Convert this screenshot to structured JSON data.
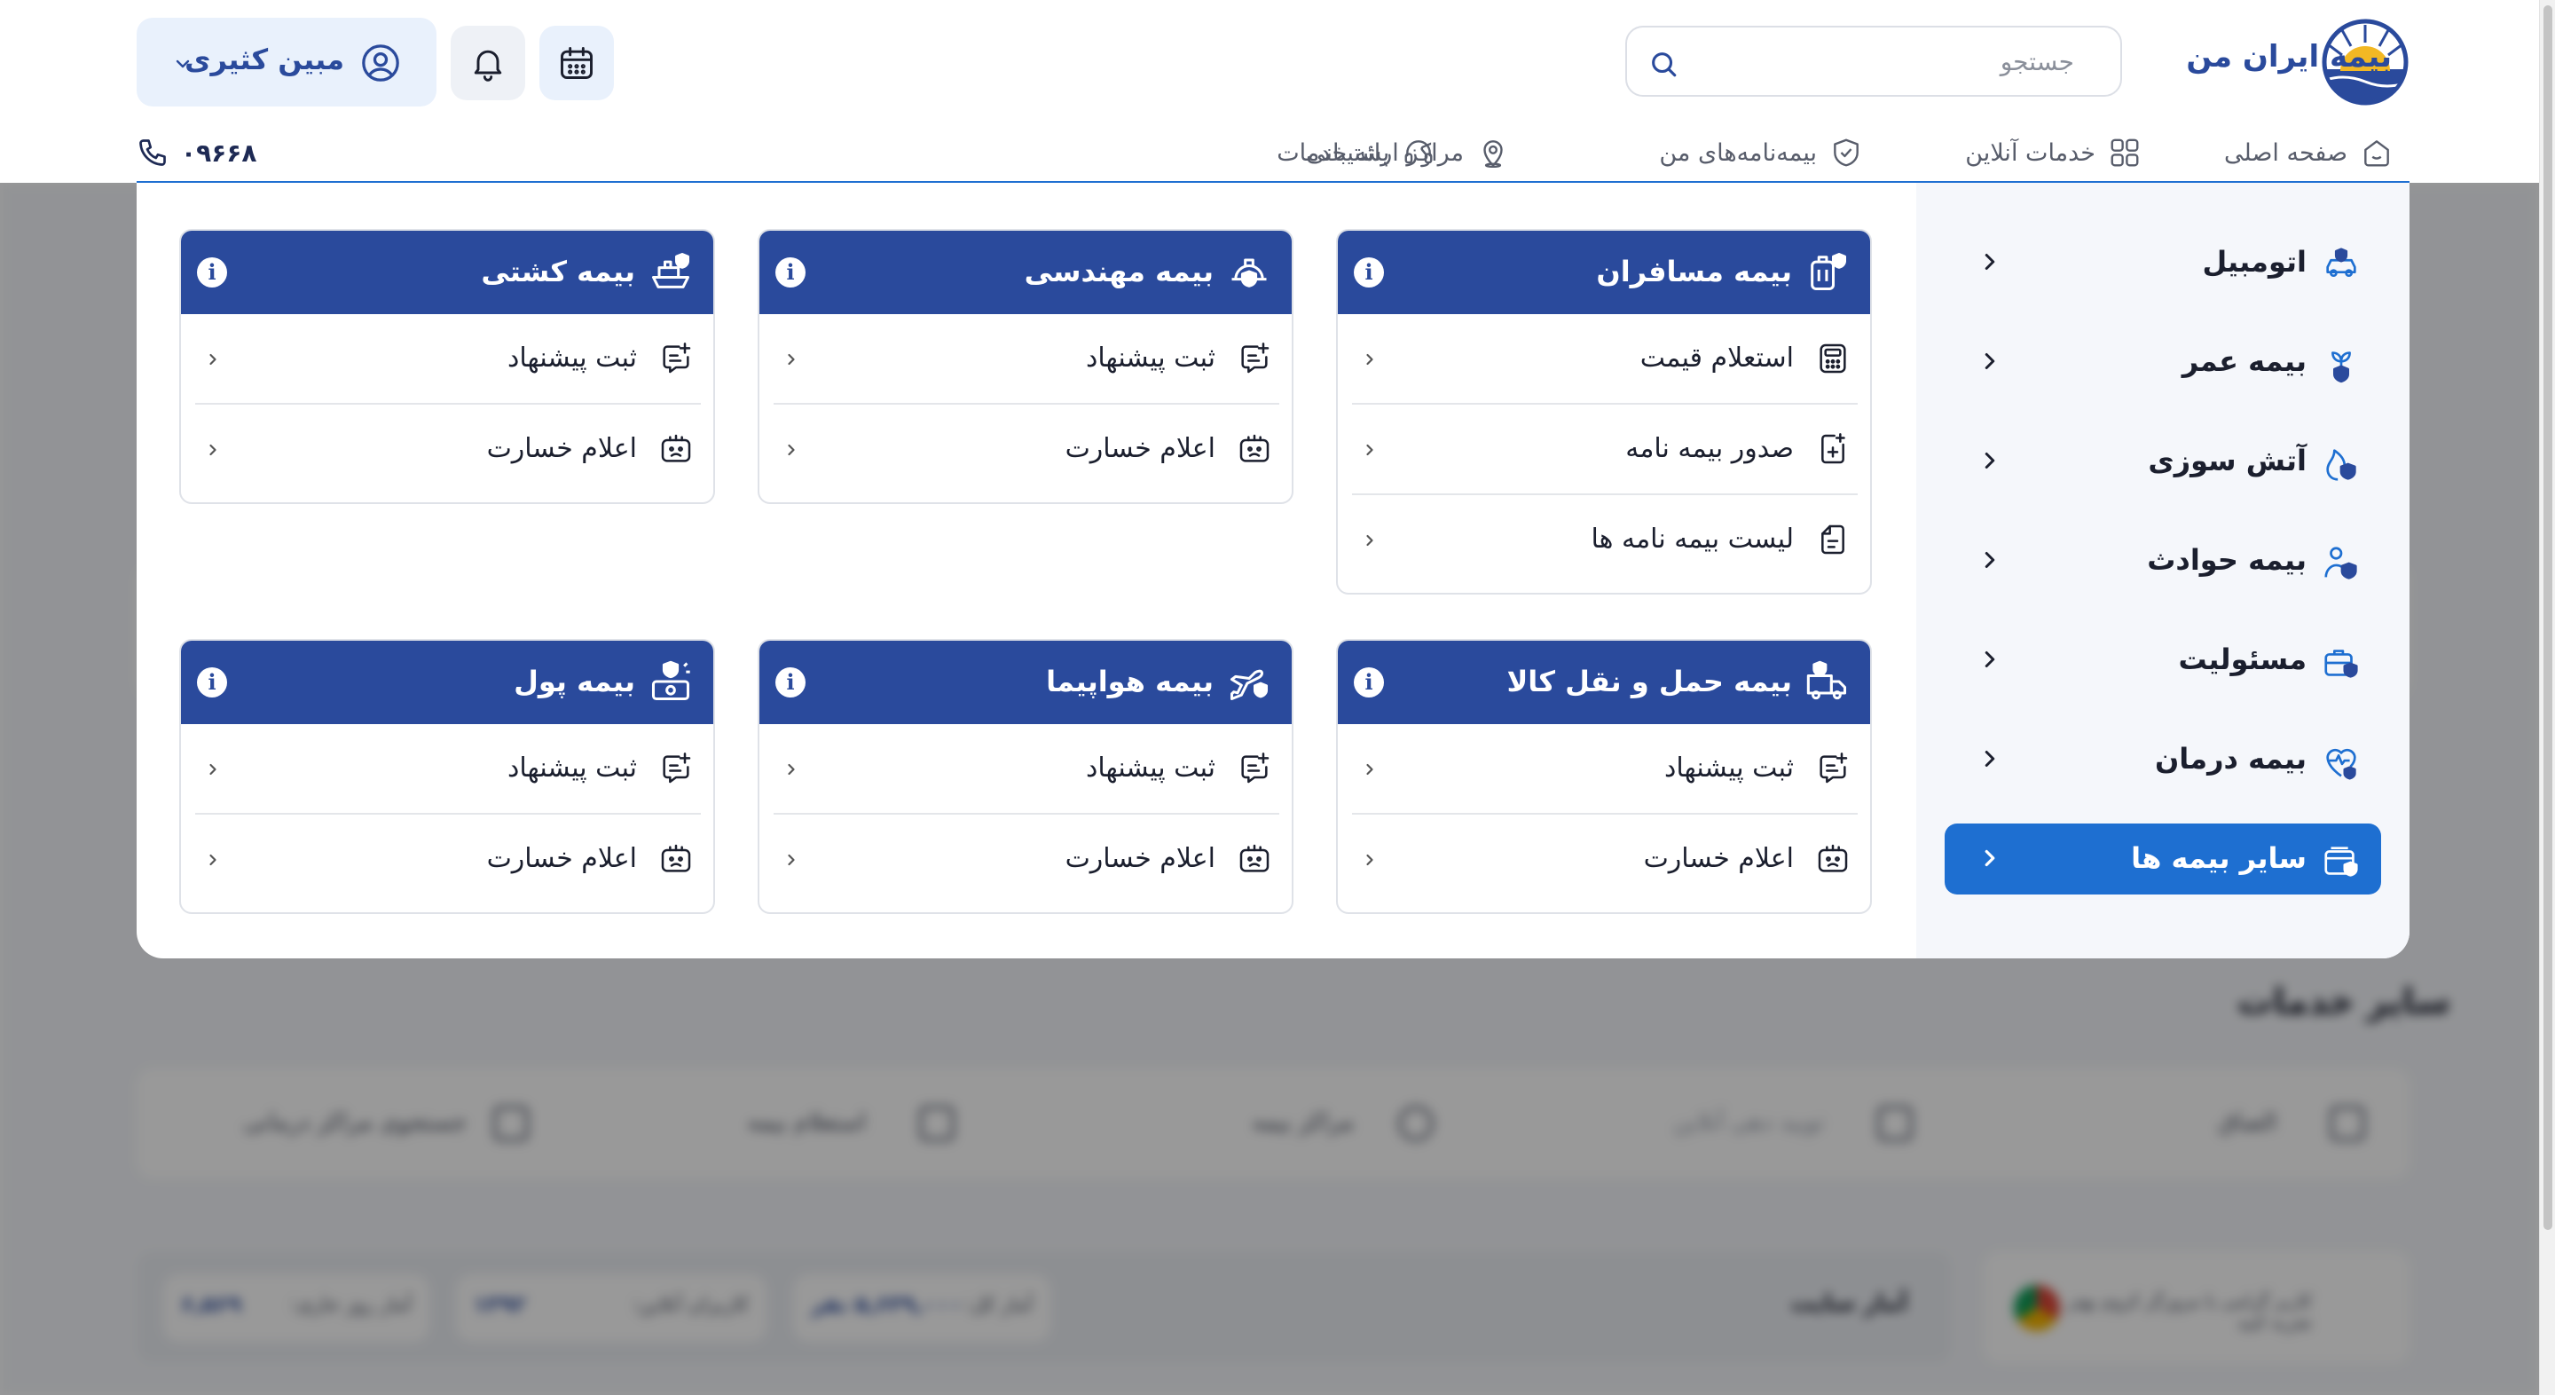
{
  "brand": {
    "name": "بیمه ایران من",
    "colors": {
      "primary": "#2a4a9c",
      "accent": "#1e6fd1",
      "logo_yellow": "#f2b824"
    }
  },
  "header": {
    "search_placeholder": "جستجو",
    "user_name": "مبین کثیری",
    "phone": "۰۹۶۶۸",
    "nav": [
      {
        "label": "صفحه اصلی",
        "icon": "home-icon"
      },
      {
        "label": "خدمات آنلاین",
        "icon": "grid-icon"
      },
      {
        "label": "بیمه‌نامه‌های من",
        "icon": "shield-icon"
      },
      {
        "label": "مراکز ارائه خدمات",
        "icon": "location-pin-icon"
      },
      {
        "label": "پشتیبانی",
        "icon": "headset-icon"
      }
    ]
  },
  "menu": {
    "categories": [
      {
        "label": "اتومبیل",
        "icon": "car-shield-icon",
        "active": false
      },
      {
        "label": "بیمه عمر",
        "icon": "plant-shield-icon",
        "active": false
      },
      {
        "label": "آتش سوزی",
        "icon": "fire-shield-icon",
        "active": false
      },
      {
        "label": "بیمه حوادث",
        "icon": "person-shield-icon",
        "active": false
      },
      {
        "label": "مسئولیت",
        "icon": "briefcase-shield-icon",
        "active": false
      },
      {
        "label": "بیمه درمان",
        "icon": "heart-pulse-icon",
        "active": false
      },
      {
        "label": "سایر بیمه ها",
        "icon": "wallet-shield-icon",
        "active": true
      }
    ],
    "panels": [
      {
        "title": "بیمه مسافران",
        "icon": "luggage-shield-icon",
        "items": [
          {
            "label": "استعلام قیمت",
            "icon": "calculator-icon"
          },
          {
            "label": "صدور بیمه نامه",
            "icon": "document-plus-icon"
          },
          {
            "label": "لیست بیمه نامه ها",
            "icon": "document-list-icon"
          }
        ]
      },
      {
        "title": "بیمه مهندسی",
        "icon": "helmet-shield-icon",
        "items": [
          {
            "label": "ثبت پیشنهاد",
            "icon": "chat-plus-icon"
          },
          {
            "label": "اعلام خسارت",
            "icon": "damage-report-icon"
          }
        ]
      },
      {
        "title": "بیمه کشتی",
        "icon": "ship-shield-icon",
        "items": [
          {
            "label": "ثبت پیشنهاد",
            "icon": "chat-plus-icon"
          },
          {
            "label": "اعلام خسارت",
            "icon": "damage-report-icon"
          }
        ]
      },
      {
        "title": "بیمه حمل و نقل کالا",
        "icon": "truck-shield-icon",
        "items": [
          {
            "label": "ثبت پیشنهاد",
            "icon": "chat-plus-icon"
          },
          {
            "label": "اعلام خسارت",
            "icon": "damage-report-icon"
          }
        ]
      },
      {
        "title": "بیمه هواپیما",
        "icon": "plane-shield-icon",
        "items": [
          {
            "label": "ثبت پیشنهاد",
            "icon": "chat-plus-icon"
          },
          {
            "label": "اعلام خسارت",
            "icon": "damage-report-icon"
          }
        ]
      },
      {
        "title": "بیمه پول",
        "icon": "money-shield-icon",
        "items": [
          {
            "label": "ثبت پیشنهاد",
            "icon": "chat-plus-icon"
          },
          {
            "label": "اعلام خسارت",
            "icon": "damage-report-icon"
          }
        ]
      }
    ]
  },
  "background": {
    "section_title": "سایر خدمات",
    "services": [
      "الصاق",
      "تویید دهی آنلاین",
      "مراکز بیمه",
      "استعلام بیمه",
      "جستجوی مراکز درمانی"
    ],
    "stats_title": "آمار سایت",
    "stats": [
      {
        "label": "آمار کل:",
        "value": "۵,۶۳۹,۰۰۰ نفر"
      },
      {
        "label": "کاربران آنلاین:",
        "value": "۱۳۹۲"
      },
      {
        "label": "آمار روز جاری:",
        "value": "۶,۵۶۹"
      }
    ],
    "browser_note": "کاربر گرامی با مرورگر کروم بهتر تجربه کنید"
  }
}
